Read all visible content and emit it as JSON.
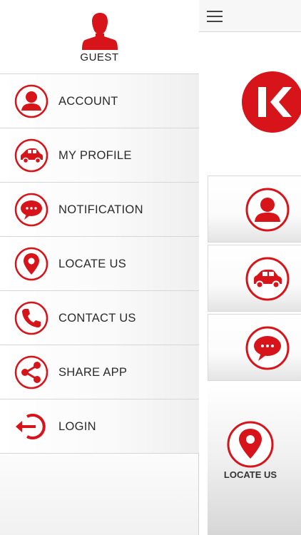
{
  "drawer": {
    "user_name": "GUEST",
    "items": [
      {
        "label": "ACCOUNT",
        "icon": "account-icon"
      },
      {
        "label": "MY PROFILE",
        "icon": "car-icon"
      },
      {
        "label": "NOTIFICATION",
        "icon": "chat-bubble-icon"
      },
      {
        "label": "LOCATE US",
        "icon": "location-pin-icon"
      },
      {
        "label": "CONTACT US",
        "icon": "phone-icon"
      },
      {
        "label": "SHARE APP",
        "icon": "share-icon"
      },
      {
        "label": "LOGIN",
        "icon": "login-icon"
      }
    ]
  },
  "content": {
    "menu_icon": "hamburger-icon",
    "logo": "brand-k-logo",
    "tiles": [
      {
        "icon": "account-icon"
      },
      {
        "icon": "car-icon"
      },
      {
        "icon": "chat-bubble-icon"
      }
    ],
    "locate_label": "LOCATE US"
  },
  "colors": {
    "accent": "#d7141a",
    "text": "#2a2a2a",
    "divider": "#d6d6d6"
  }
}
